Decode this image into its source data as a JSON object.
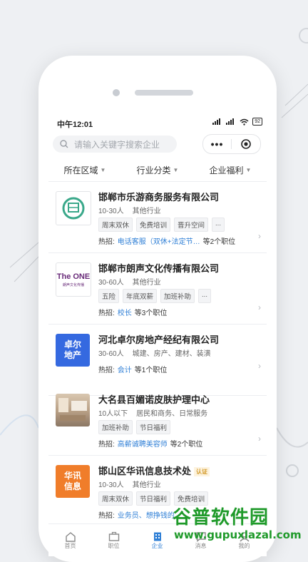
{
  "status_bar": {
    "time": "中午12:01",
    "battery": "92"
  },
  "search": {
    "placeholder": "请输入关键字搜索企业"
  },
  "capsule": {
    "more": "•••"
  },
  "filters": [
    "所在区域",
    "行业分类",
    "企业福利"
  ],
  "companies": [
    {
      "name": "邯郸市乐游商务服务有限公司",
      "size": "10-30人",
      "industry": "其他行业",
      "tags": [
        "周末双休",
        "免费培训",
        "晋升空间",
        "..."
      ],
      "hot_label": "热招:",
      "hot_job": "电话客服（双休+法定节…",
      "hot_count": "等2个职位",
      "logo": "leyou"
    },
    {
      "name": "邯郸市朗声文化传播有限公司",
      "size": "30-60人",
      "industry": "其他行业",
      "tags": [
        "五险",
        "年底双薪",
        "加班补助",
        "..."
      ],
      "hot_label": "热招:",
      "hot_job": "校长",
      "hot_count": "等3个职位",
      "logo_text": "The ONE",
      "logo_sub": "朗声文化传播"
    },
    {
      "name": "河北卓尔房地产经纪有限公司",
      "size": "30-60人",
      "industry": "城建、房产、建材、装潢",
      "tags": [],
      "hot_label": "热招:",
      "hot_job": "会计",
      "hot_count": "等1个职位",
      "logo_text": "卓尔地产"
    },
    {
      "name": "大名县百媚诺皮肤护理中心",
      "size": "10人以下",
      "industry": "居民和商务、日常服务",
      "tags": [
        "加班补助",
        "节日福利"
      ],
      "hot_label": "热招:",
      "hot_job": "高薪诚聘美容师",
      "hot_count": "等2个职位",
      "logo": "photo"
    },
    {
      "name": "邯山区华讯信息技术处",
      "badge": "认证",
      "size": "10-30人",
      "industry": "其他行业",
      "tags": [
        "周末双休",
        "节日福利",
        "免费培训"
      ],
      "hot_label": "热招:",
      "hot_job": "业务员、想挣钱的",
      "hot_count": "",
      "logo_text": "华讯信息"
    }
  ],
  "tabbar": [
    {
      "label": "首页",
      "icon": "home-icon"
    },
    {
      "label": "职位",
      "icon": "briefcase-icon"
    },
    {
      "label": "企业",
      "icon": "building-icon"
    },
    {
      "label": "消息",
      "icon": "message-icon"
    },
    {
      "label": "我的",
      "icon": "user-icon"
    }
  ],
  "watermark": {
    "title": "谷普软件园",
    "url": "www.gupuxlazal.com"
  },
  "colors": {
    "accent": "#2f7fd6",
    "watermark": "#1f9a2a",
    "zhuoer": "#3569e0",
    "huaxun": "#f07d2a"
  }
}
